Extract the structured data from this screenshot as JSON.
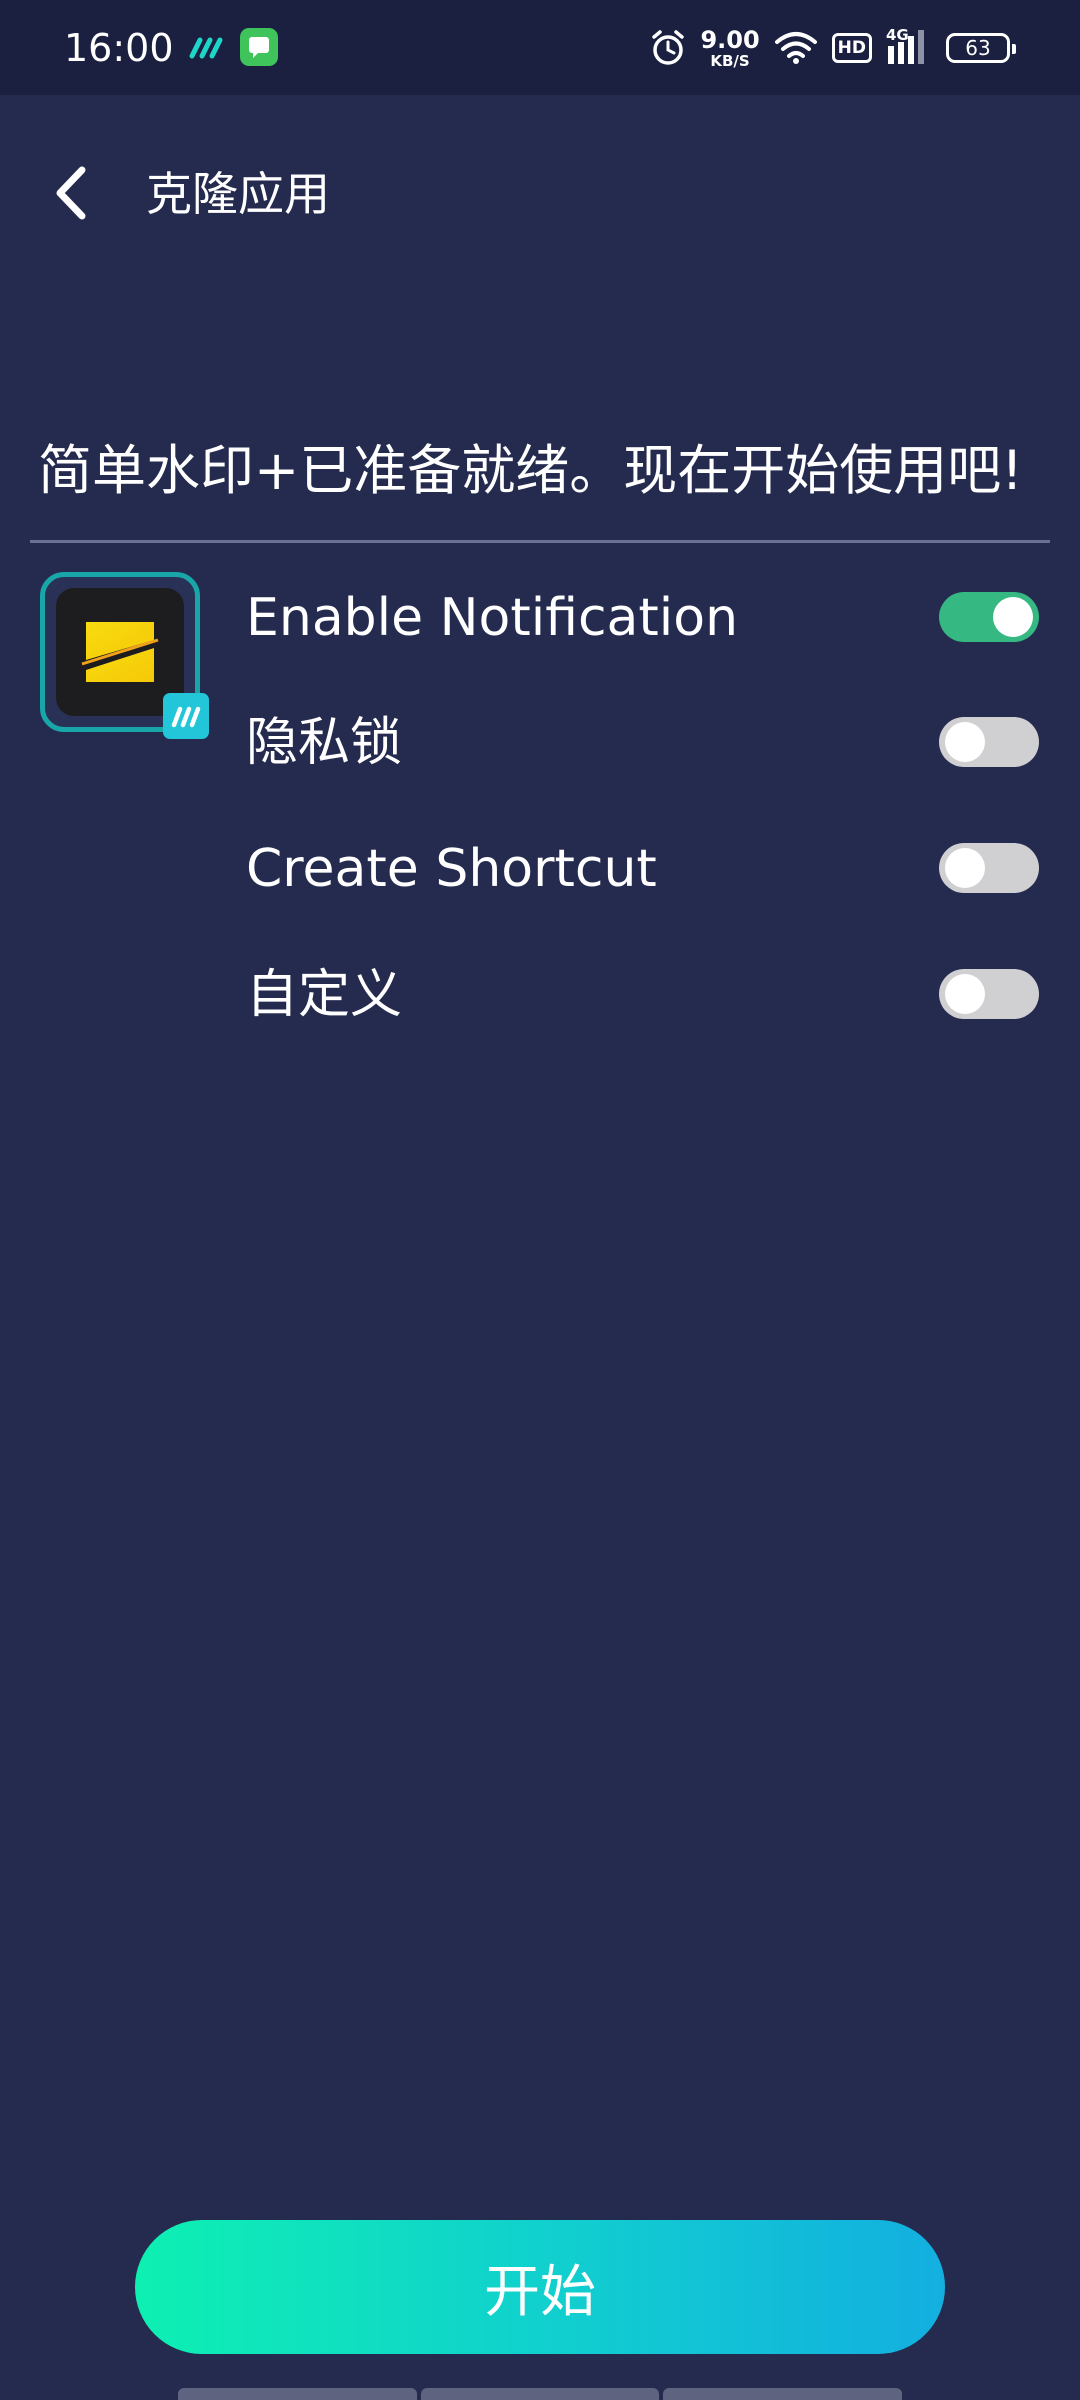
{
  "status_bar": {
    "time": "16:00",
    "net_speed_value": "9.00",
    "net_speed_unit": "KB/S",
    "hd_label": "HD",
    "network_type": "4G",
    "battery_level": "63",
    "icons": [
      "wps-app-icon",
      "message-app-icon",
      "alarm-icon",
      "wifi-icon",
      "hd-icon",
      "signal-icon",
      "battery-icon"
    ]
  },
  "header": {
    "title": "克隆应用",
    "back_icon": "chevron-left-icon"
  },
  "ready_message": "简单水印+已准备就绪。现在开始使用吧!",
  "app": {
    "icon": "watermark-app-icon",
    "badge_icon": "clone-badge-icon",
    "colors": {
      "border": "#18a6a8",
      "icon_bg": "#1d1d1f",
      "stripe": "#f6d20a",
      "badge": "#22c6d8"
    }
  },
  "settings": [
    {
      "label": "Enable Notification",
      "enabled": true
    },
    {
      "label": "隐私锁",
      "enabled": false
    },
    {
      "label": "Create Shortcut",
      "enabled": false
    },
    {
      "label": "自定义",
      "enabled": false
    }
  ],
  "start_button": {
    "label": "开始"
  },
  "colors": {
    "background": "#252b4f",
    "status_bar": "#1b2040",
    "toggle_on": "#35b882",
    "toggle_off": "#d0d0d2",
    "button_gradient_start": "#0ef0b2",
    "button_gradient_end": "#13afe0"
  }
}
